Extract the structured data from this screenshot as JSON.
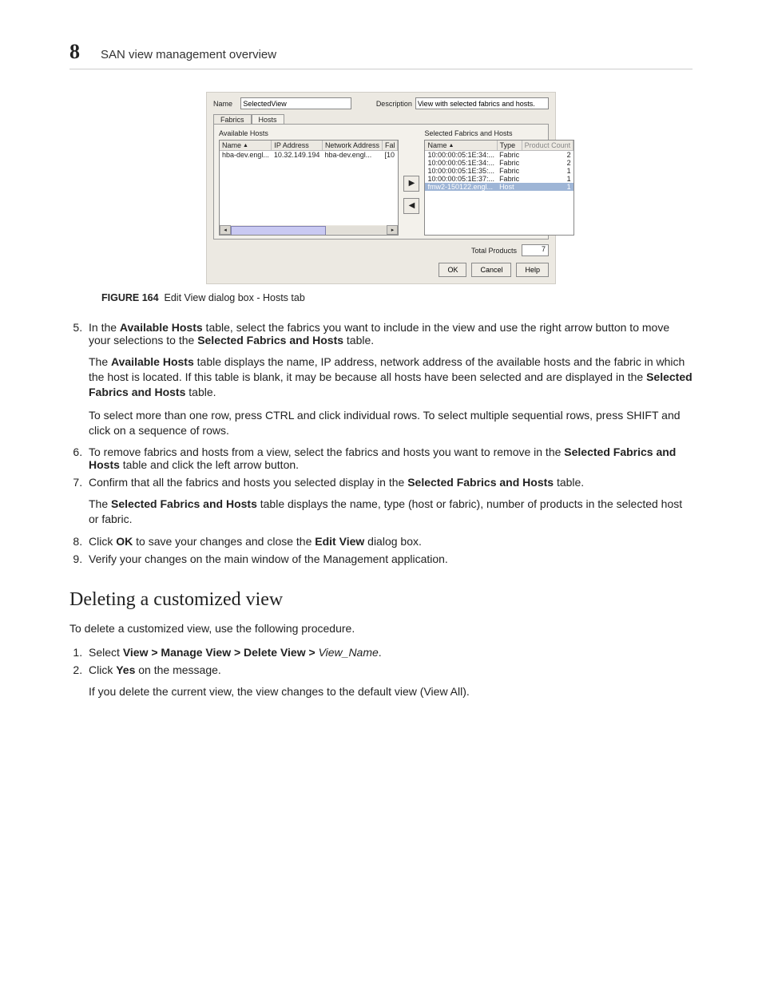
{
  "header": {
    "chapter_number": "8",
    "chapter_title": "SAN view management overview"
  },
  "dialog": {
    "name_label": "Name",
    "name_value": "SelectedView",
    "desc_label": "Description",
    "desc_value": "View with selected fabrics and hosts.",
    "tabs": {
      "fabrics": "Fabrics",
      "hosts": "Hosts"
    },
    "left": {
      "title": "Available Hosts",
      "cols": [
        "Name",
        "IP Address",
        "Network Address",
        "Fal"
      ],
      "rows": [
        {
          "name": "hba-dev.engl...",
          "ip": "10.32.149.194",
          "net": "hba-dev.engl...",
          "fab": "[10"
        }
      ]
    },
    "arrow_right": "▶",
    "arrow_left": "◀",
    "right": {
      "title": "Selected Fabrics and Hosts",
      "cols": [
        "Name",
        "Type",
        "Product Count"
      ],
      "rows": [
        {
          "name": "10:00:00:05:1E:34:...",
          "type": "Fabric",
          "count": "2",
          "sel": false
        },
        {
          "name": "10:00:00:05:1E:34:...",
          "type": "Fabric",
          "count": "2",
          "sel": false
        },
        {
          "name": "10:00:00:05:1E:35:...",
          "type": "Fabric",
          "count": "1",
          "sel": false
        },
        {
          "name": "10:00:00:05:1E:37:...",
          "type": "Fabric",
          "count": "1",
          "sel": false
        },
        {
          "name": "fmw2-150122.engl...",
          "type": "Host",
          "count": "1",
          "sel": true
        }
      ]
    },
    "totals_label": "Total Products",
    "totals_value": "7",
    "buttons": {
      "ok": "OK",
      "cancel": "Cancel",
      "help": "Help"
    }
  },
  "figure": {
    "label": "FIGURE 164",
    "caption": "Edit View dialog box - Hosts tab"
  },
  "steps1": {
    "s5": {
      "a": "In the ",
      "b": "Available Hosts",
      "c": " table, select the fabrics you want to include in the view and use the right arrow button to move your selections to the ",
      "d": "Selected Fabrics and Hosts",
      "e": " table."
    },
    "p5a": {
      "a": "The ",
      "b": "Available Hosts",
      "c": " table displays the name, IP address, network address of the available hosts and the fabric in which the host is located. If this table is blank, it may be because all hosts have been selected and are displayed in the ",
      "d": "Selected Fabrics and Hosts",
      "e": " table."
    },
    "p5b": "To select more than one row, press CTRL and click individual rows. To select multiple sequential rows, press SHIFT and click on a sequence of rows.",
    "s6": {
      "a": "To remove fabrics and hosts from a view, select the fabrics and hosts you want to remove in the ",
      "b": "Selected Fabrics and Hosts",
      "c": " table and click the left arrow button."
    },
    "s7": {
      "a": "Confirm that all the fabrics and hosts you selected display in the ",
      "b": "Selected Fabrics and Hosts",
      "c": " table."
    },
    "p7": {
      "a": "The ",
      "b": "Selected Fabrics and Hosts",
      "c": " table displays the name, type (host or fabric), number of products in the selected host or fabric."
    },
    "s8": {
      "a": "Click ",
      "b": "OK",
      "c": " to save your changes and close the ",
      "d": "Edit View",
      "e": " dialog box."
    },
    "s9": "Verify your changes on the main window of the Management application."
  },
  "section2": {
    "title": "Deleting a customized view",
    "intro": "To delete a customized view, use the following procedure.",
    "s1": {
      "a": "Select ",
      "b": "View > Manage View > Delete View > ",
      "c": "View_Name",
      "d": "."
    },
    "s2": {
      "a": "Click ",
      "b": "Yes",
      "c": " on the message."
    },
    "p2": "If you delete the current view, the view changes to the default view (View All)."
  }
}
